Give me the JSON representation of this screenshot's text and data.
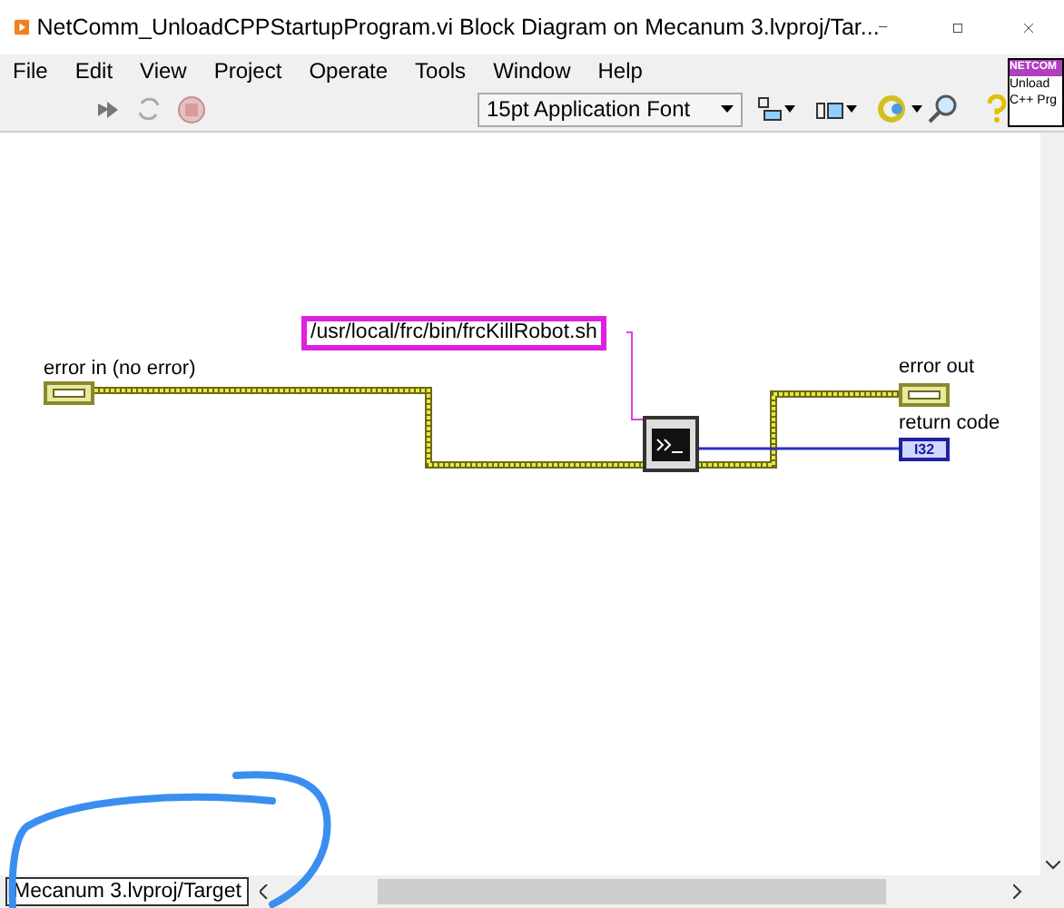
{
  "window": {
    "title": "NetComm_UnloadCPPStartupProgram.vi Block Diagram on Mecanum 3.lvproj/Tar..."
  },
  "menu": [
    "File",
    "Edit",
    "View",
    "Project",
    "Operate",
    "Tools",
    "Window",
    "Help"
  ],
  "toolbar": {
    "font_dropdown": "15pt Application Font"
  },
  "icon_pane": {
    "header": "NETCOM",
    "lines": [
      "Unload",
      "C++ Prg"
    ]
  },
  "diagram": {
    "string_constant": "/usr/local/frc/bin/frcKillRobot.sh",
    "terminals": [
      {
        "kind": "error",
        "label": "error in (no error)"
      },
      {
        "kind": "error",
        "label": "error out"
      },
      {
        "kind": "i32",
        "label": "return code",
        "type": "I32"
      }
    ]
  },
  "status_bar": {
    "context": "Mecanum 3.lvproj/Target"
  }
}
